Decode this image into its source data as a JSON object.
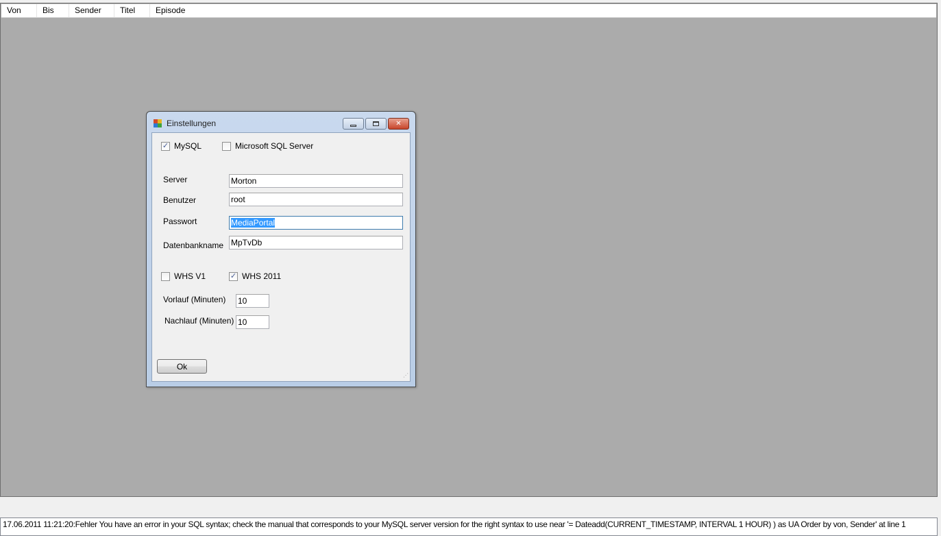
{
  "grid": {
    "columns": [
      "Von",
      "Bis",
      "Sender",
      "Titel",
      "Episode"
    ]
  },
  "dialog": {
    "title": "Einstellungen",
    "db_options": {
      "mysql": {
        "label": "MySQL",
        "checked": true
      },
      "mssql": {
        "label": "Microsoft SQL Server",
        "checked": false
      }
    },
    "fields": {
      "server": {
        "label": "Server",
        "value": "Morton"
      },
      "user": {
        "label": "Benutzer",
        "value": "root"
      },
      "password": {
        "label": "Passwort",
        "value": "MediaPortal"
      },
      "dbname": {
        "label": "Datenbankname",
        "value": "MpTvDb"
      }
    },
    "whs": {
      "v1": {
        "label": "WHS V1",
        "checked": false
      },
      "v2011": {
        "label": "WHS 2011",
        "checked": true
      }
    },
    "timing": {
      "vorlauf": {
        "label": "Vorlauf (Minuten)",
        "value": "10"
      },
      "nachlauf": {
        "label": "Nachlauf (Minuten)",
        "value": "10"
      }
    },
    "ok_label": "Ok"
  },
  "log": {
    "text": "17.06.2011 11:21:20:Fehler You have an error in your SQL syntax; check the manual that corresponds to your MySQL server version for the right syntax to use near '= Dateadd(CURRENT_TIMESTAMP, INTERVAL 1 HOUR) ) as UA  Order by von, Sender' at line 1"
  },
  "icons": {
    "checkmark": "✓",
    "minimize": "minimize-icon",
    "maximize": "maximize-icon",
    "close": "close-icon"
  }
}
